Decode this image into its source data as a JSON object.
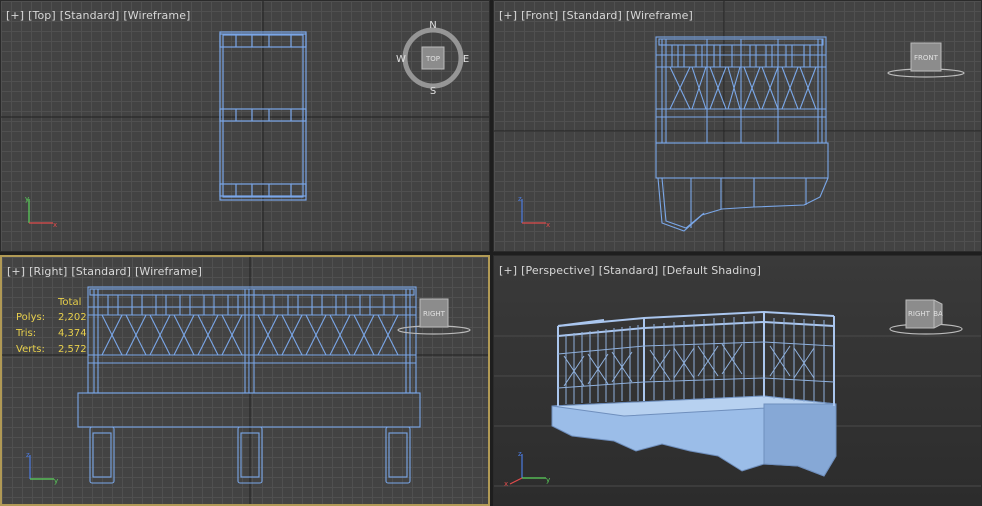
{
  "viewports": {
    "top": {
      "labels": [
        "[+]",
        "[Top]",
        "[Standard]",
        "[Wireframe]"
      ],
      "cube_label": "TOP",
      "compass": {
        "n": "N",
        "s": "S",
        "e": "E",
        "w": "W"
      }
    },
    "front": {
      "labels": [
        "[+]",
        "[Front]",
        "[Standard]",
        "[Wireframe]"
      ],
      "cube_label": "FRONT"
    },
    "right": {
      "labels": [
        "[+]",
        "[Right]",
        "[Standard]",
        "[Wireframe]"
      ],
      "cube_label": "RIGHT"
    },
    "perspective": {
      "labels": [
        "[+]",
        "[Perspective]",
        "[Standard]",
        "[Default Shading]"
      ],
      "cube_label": "RIGHT",
      "cube_label_side": "BA"
    }
  },
  "stats": {
    "header": "Total",
    "rows": [
      {
        "key": "Polys:",
        "value": "2,202"
      },
      {
        "key": "Tris:",
        "value": "4,374"
      },
      {
        "key": "Verts:",
        "value": "2,572"
      }
    ]
  },
  "axis": {
    "x": "x",
    "y": "y",
    "z": "z"
  },
  "colors": {
    "wire": "#7aa7e8",
    "active_border": "#b19a55",
    "stats_text": "#e8d04c",
    "mesh_shade": "#9bbde8"
  }
}
